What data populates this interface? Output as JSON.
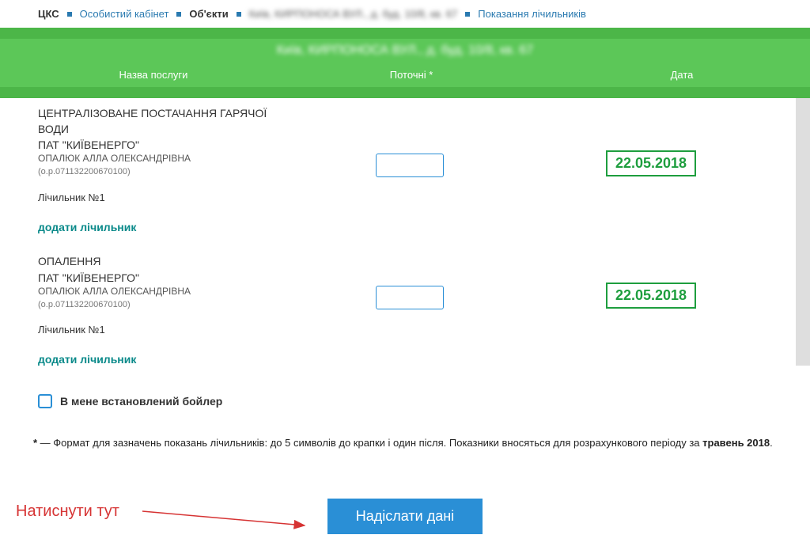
{
  "breadcrumb": {
    "root": "ЦКС",
    "cabinet": "Особистий кабінет",
    "objects": "Об'єкти",
    "address": "Київ, КИРПОНОСА ВУЛ., д. буд. 10/8, кв. 67",
    "meters": "Показання лічильників"
  },
  "banner": {
    "address": "Київ, КИРПОНОСА ВУЛ., д. буд. 10/8, кв. 67"
  },
  "table_header": {
    "service": "Назва послуги",
    "current": "Поточні *",
    "date": "Дата"
  },
  "services": [
    {
      "name": "ЦЕНТРАЛІЗОВАНЕ ПОСТАЧАННЯ ГАРЯЧОЇ ВОДИ",
      "company": "ПАТ \"КИЇВЕНЕРГО\"",
      "person": "ОПАЛЮК АЛЛА ОЛЕКСАНДРІВНА",
      "account": "(о.р.071132200670100)",
      "meter": "Лічильник №1",
      "add_meter": "додати лічильник",
      "date": "22.05.2018",
      "value": ""
    },
    {
      "name": "ОПАЛЕННЯ",
      "company": "ПАТ \"КИЇВЕНЕРГО\"",
      "person": "ОПАЛЮК АЛЛА ОЛЕКСАНДРІВНА",
      "account": "(о.р.071132200670100)",
      "meter": "Лічильник №1",
      "add_meter": "додати лічильник",
      "date": "22.05.2018",
      "value": ""
    }
  ],
  "boiler": {
    "label": "В мене встановлений бойлер"
  },
  "footnote": {
    "asterisk": "*",
    "text": " — Формат для зазначень показань лічильників: до 5 символів до крапки і один після. Показники вносяться для розрахункового періоду за ",
    "period": "травень 2018",
    "dot": "."
  },
  "annotation": "Натиснути тут",
  "submit": "Надіслати дані"
}
